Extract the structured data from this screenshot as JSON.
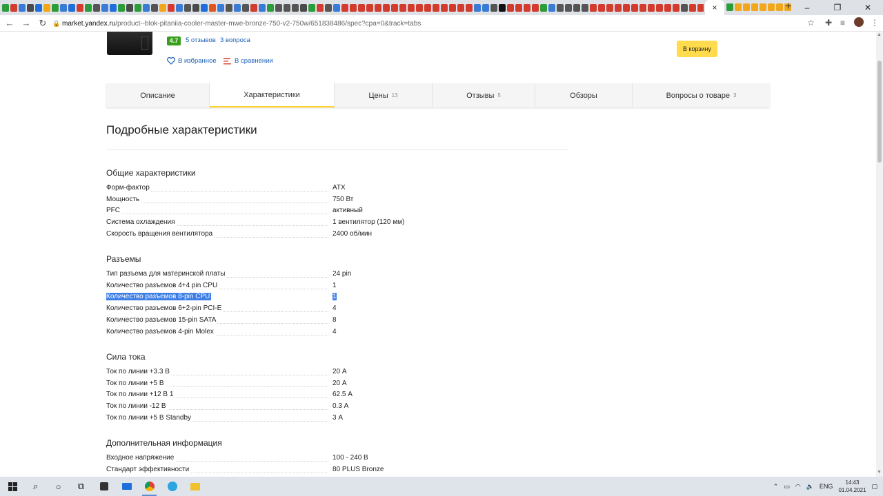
{
  "browser": {
    "favicon_colors": [
      "#2a9d3a",
      "#d23b2e",
      "#3a7bd5",
      "#4a4a4a",
      "#1e6fd9",
      "#f2a71b",
      "#2a9d3a",
      "#3a7bd5",
      "#1e6fd9",
      "#d23b2e",
      "#2a9d3a",
      "#555",
      "#3a7bd5",
      "#1e6fd9",
      "#2a9d3a",
      "#4a4a4a",
      "#2a9d3a",
      "#3a7bd5",
      "#555",
      "#f2a71b",
      "#d23b2e",
      "#3a7bd5",
      "#555",
      "#4a4a4a",
      "#1e6fd9",
      "#e2571e",
      "#3a7bd5",
      "#555",
      "#3a7bd5",
      "#555",
      "#d23b2e",
      "#3a7bd5",
      "#2a9d3a",
      "#555",
      "#555",
      "#555",
      "#4a4a4a",
      "#2a9d3a",
      "#d23b2e",
      "#555",
      "#3a7bd5",
      "#d23b2e",
      "#d23b2e",
      "#d23b2e",
      "#d23b2e",
      "#d23b2e",
      "#d23b2e",
      "#d23b2e",
      "#d23b2e",
      "#d23b2e",
      "#d23b2e",
      "#d23b2e",
      "#d23b2e",
      "#d23b2e",
      "#d23b2e",
      "#d23b2e",
      "#d23b2e",
      "#3a7bd5",
      "#3a7bd5",
      "#555",
      "#111",
      "#d23b2e",
      "#d23b2e",
      "#d23b2e",
      "#d23b2e",
      "#2a9d3a",
      "#3a7bd5",
      "#555",
      "#555",
      "#555",
      "#555",
      "#d23b2e",
      "#d23b2e",
      "#d23b2e",
      "#d23b2e",
      "#d23b2e",
      "#d23b2e",
      "#d23b2e",
      "#d23b2e",
      "#d23b2e",
      "#d23b2e",
      "#d23b2e",
      "#555",
      "#d23b2e",
      "#d23b2e",
      "#d23b2e",
      "#d23b2e",
      "#d23b2e",
      "#d23b2e",
      "#d23b2e",
      "#d23b2e",
      "#d23b2e",
      "#d23b2e",
      "#d23b2e",
      "#d23b2e",
      "#d23b2e",
      "#111",
      "#f2a71b",
      "#f2a71b",
      "#111"
    ],
    "active_tab_close": "×",
    "tail_favicon_colors": [
      "#2a9d3a",
      "#f2a71b",
      "#f2a71b",
      "#f2a71b",
      "#f2a71b",
      "#f2a71b",
      "#f2a71b",
      "#f2a71b"
    ],
    "new_tab": "+",
    "window_controls": [
      "–",
      "❐",
      "✕"
    ],
    "url_host": "market.yandex.ru",
    "url_path": "/product--blok-pitaniia-cooler-master-mwe-bronze-750-v2-750w/651838486/spec?cpa=0&track=tabs"
  },
  "product": {
    "rating": "4.7",
    "reviews_link": "5 отзывов",
    "questions_link": "3 вопроса",
    "favorite_label": "В избранное",
    "compare_label": "В сравнении",
    "cart_button": "В корзину"
  },
  "tabs": [
    {
      "label": "Описание",
      "count": ""
    },
    {
      "label": "Характеристики",
      "count": ""
    },
    {
      "label": "Цены",
      "count": "13"
    },
    {
      "label": "Отзывы",
      "count": "5"
    },
    {
      "label": "Обзоры",
      "count": ""
    },
    {
      "label": "Вопросы о товаре",
      "count": "3"
    }
  ],
  "page_title": "Подробные характеристики",
  "spec_groups": [
    {
      "title": "Общие характеристики",
      "rows": [
        {
          "name": "Форм-фактор",
          "value": "ATX"
        },
        {
          "name": "Мощность",
          "value": "750 Вт"
        },
        {
          "name": "PFC",
          "value": "активный"
        },
        {
          "name": "Система охлаждения",
          "value": "1 вентилятор (120 мм)"
        },
        {
          "name": "Скорость вращения вентилятора",
          "value": "2400 об/мин"
        }
      ]
    },
    {
      "title": "Разъемы",
      "rows": [
        {
          "name": "Тип разъема для материнской платы",
          "value": "24 pin"
        },
        {
          "name": "Количество разъемов 4+4 pin CPU",
          "value": "1"
        },
        {
          "name": "Количество разъемов 8-pin CPU",
          "value": "1"
        },
        {
          "name": "Количество разъемов 6+2-pin PCI-E",
          "value": "4"
        },
        {
          "name": "Количество разъемов 15-pin SATA",
          "value": "8"
        },
        {
          "name": "Количество разъемов 4-pin Molex",
          "value": "4"
        }
      ]
    },
    {
      "title": "Сила тока",
      "rows": [
        {
          "name": "Ток по линии +3.3 В",
          "value": "20 А"
        },
        {
          "name": "Ток по линии +5 В",
          "value": "20 А"
        },
        {
          "name": "Ток по линии +12 В 1",
          "value": "62.5 А"
        },
        {
          "name": "Ток по линии -12 В",
          "value": "0.3 А"
        },
        {
          "name": "Ток по линии +5 В Standby",
          "value": "3 А"
        }
      ]
    },
    {
      "title": "Дополнительная информация",
      "rows": [
        {
          "name": "Входное напряжение",
          "value": "100 - 240 В"
        },
        {
          "name": "Стандарт эффективности",
          "value": "80 PLUS Bronze"
        }
      ]
    }
  ],
  "taskbar": {
    "language": "ENG",
    "time": "14:43",
    "date": "01.04.2021"
  }
}
